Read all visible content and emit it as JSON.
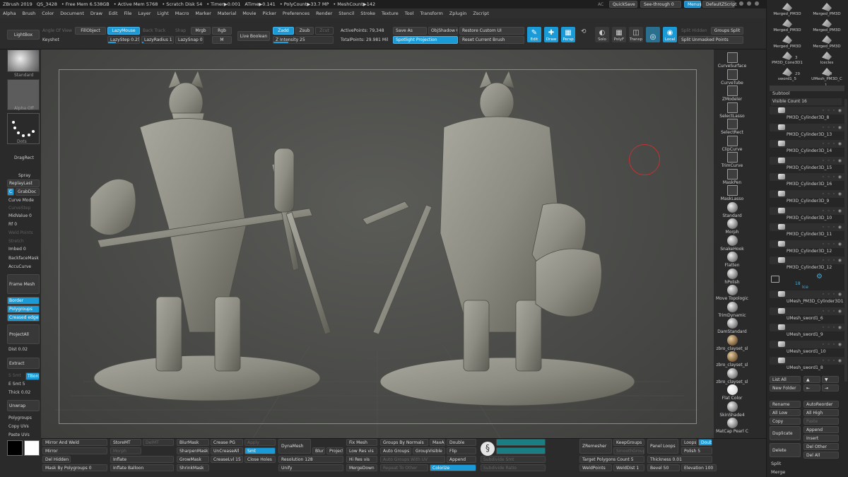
{
  "titlebar": {
    "app": "ZBrush 2019",
    "doc": "QS_3428",
    "stats": [
      "• Free Mem 6.538GB",
      "• Active Mem 5768",
      "• Scratch Disk 54",
      "• Timer▶0.001",
      "ATime▶0.141",
      "• PolyCount▶33.7 MP",
      "• MeshCount▶142"
    ],
    "ac": "AC",
    "quicksave": "QuickSave",
    "see_through": "See-through   0",
    "menus": "Menus",
    "default_zscript": "DefaultZScript"
  },
  "menubar": [
    "Alpha",
    "Brush",
    "Color",
    "Document",
    "Draw",
    "Edit",
    "File",
    "Layer",
    "Light",
    "Macro",
    "Marker",
    "Material",
    "Movie",
    "Picker",
    "Preferences",
    "Render",
    "Stencil",
    "Stroke",
    "Texture",
    "Tool",
    "Transform",
    "Zplugin",
    "Zscript"
  ],
  "shelf": {
    "lightbox": "LightBox",
    "keyshot": "Keyshot",
    "angle_of_view": "Angle Of View",
    "fill_object": "FillObject",
    "lazy_mouse": "LazyMouse",
    "back_track": "Back Track",
    "lazy_step": "LazyStep 0.25",
    "lazy_radius": "LazyRadius 1",
    "lazy_snap": "LazySnap 0",
    "mrgb": "Mrgb",
    "rgb": "Rgb",
    "m": "M",
    "shape": "Shap",
    "live_boolean": "Live Boolean",
    "zadd": "Zadd",
    "zsub": "Zsub",
    "zcut": "Zcut",
    "z_intensity": "Z Intensity 25",
    "active_points": "ActivePoints: 79,348",
    "total_points": "TotalPoints: 29.981 Mil",
    "save_as": "Save As",
    "obj_shadow": "ObjShadow 0",
    "spotlight_projection": "Spotlight Projection",
    "restore_custom_ui": "Restore Custom UI",
    "reset_current_brush": "Reset Current Brush",
    "edit": "Edit",
    "draw": "Draw",
    "persp": "Persp",
    "solo": "Solo",
    "polyf": "PolyF",
    "transp": "Transp",
    "local": "Local",
    "split_hidden": "Split Hidden",
    "groups_split": "Groups Split",
    "split_unmasked_points": "Split Unmasked Points"
  },
  "leftshelf": {
    "standard": "Standard",
    "alpha_off": "Alpha Off",
    "dots": "Dots",
    "dragrect": "DragRect",
    "spray": "Spray",
    "replay_last": "ReplayLast",
    "c": "C",
    "grab_doc": "GrabDoc",
    "curve_mode": "Curve Mode",
    "curve_step": "CurveStep",
    "mid_value": "MidValue 0",
    "rf": "Rf 0",
    "weld_points": "Weld Points",
    "stretch": "Stretch",
    "imbed": "Imbed 0",
    "backface_mask": "BackfaceMask",
    "accu_curve": "AccuCurve",
    "frame_mesh": "Frame Mesh",
    "border": "Border",
    "polygroups": "Polygroups",
    "creased_edges": "Creased edges",
    "project_all": "ProjectAll",
    "dist": "Dist 0.02",
    "extract": "Extract",
    "e_smt": "E Smt 5",
    "s_smt": "S Smt",
    "tborder": "TBorder",
    "thick": "Thick 0.02",
    "unwrap": "Unwrap",
    "polygroups2": "Polygroups",
    "copy_uvs": "Copy UVs",
    "paste_uvs": "Paste UVs"
  },
  "rightshelf": [
    {
      "name": "curvesurface-brush",
      "label": "CurveSurface",
      "kind": "spike"
    },
    {
      "name": "curvetube-brush",
      "label": "CurveTube",
      "kind": "tube"
    },
    {
      "name": "zmodeler-brush",
      "label": "ZModeler",
      "kind": "cube"
    },
    {
      "name": "selectlasso-tool",
      "label": "SelectLasso",
      "kind": "lasso"
    },
    {
      "name": "selectrect-tool",
      "label": "SelectRect",
      "kind": "rect"
    },
    {
      "name": "clipcurve-tool",
      "label": "ClipCurve",
      "kind": "lasso"
    },
    {
      "name": "trimcurve-tool",
      "label": "TrimCurve",
      "kind": "lasso"
    },
    {
      "name": "maskpen-tool",
      "label": "MaskPen",
      "kind": "lasso"
    },
    {
      "name": "masklasso-tool",
      "label": "MaskLasso",
      "kind": "lasso"
    },
    {
      "name": "standard-brush",
      "label": "Standard",
      "kind": "sphere"
    },
    {
      "name": "morph-brush",
      "label": "Morph",
      "kind": "sphere"
    },
    {
      "name": "snakehook-brush",
      "label": "SnakeHook",
      "kind": "sphere"
    },
    {
      "name": "flatten-brush",
      "label": "Flatten",
      "kind": "sphere"
    },
    {
      "name": "hpolish-brush",
      "label": "hPolish",
      "kind": "sphere"
    },
    {
      "name": "move-topological-brush",
      "label": "Move Topologic",
      "kind": "sphere"
    },
    {
      "name": "trimdynamic-brush",
      "label": "TrimDynamic",
      "kind": "sphere"
    },
    {
      "name": "damstandard-brush",
      "label": "DamStandard",
      "kind": "sphere"
    },
    {
      "name": "clayset-1",
      "label": "zbro_clayset_sl",
      "kind": "clay"
    },
    {
      "name": "clayset-2",
      "label": "zbro_clayset_sl",
      "kind": "clay"
    },
    {
      "name": "clayset-3",
      "label": "zbro_clayset_sl",
      "kind": "sphere"
    },
    {
      "name": "flat-color-material",
      "label": "Flat Color",
      "kind": "flat"
    },
    {
      "name": "skinshade4-material",
      "label": "SkinShade4",
      "kind": "sphere"
    },
    {
      "name": "matcap-pearl-material",
      "label": "MatCap Pearl C",
      "kind": "sphere"
    }
  ],
  "toolpanel": {
    "tiles": [
      [
        "Merged_PM3D",
        "Merged_PM3D"
      ],
      [
        "Merged_PM3D",
        "Merged_PM3D"
      ],
      [
        "Merged_PM3D",
        "Merged_PM3D"
      ],
      [
        "PM3D_Cone3D1",
        "Icecles"
      ],
      [
        "sword1_5",
        "UMesh_PM3D_C"
      ]
    ],
    "tile_counts": [
      "3",
      "10",
      "29",
      "160",
      "1"
    ],
    "subtool": "Subtool",
    "visible_count": "Visible Count 16",
    "subtools": [
      "PM3D_Cylinder3D_8",
      "PM3D_Cylinder3D_13",
      "PM3D_Cylinder3D_14",
      "PM3D_Cylinder3D_15",
      "PM3D_Cylinder3D_16",
      "PM3D_Cylinder3D_9",
      "PM3D_Cylinder3D_10",
      "PM3D_Cylinder3D_11",
      "PM3D_Cylinder3D_12",
      "PM3D_Cylinder3D_12"
    ],
    "folder_count": "18",
    "folder_name": "Ice",
    "subtools2": [
      "UMesh_PM3D_Cylinder3D1",
      "UMesh_sword1_6",
      "UMesh_sword1_9",
      "UMesh_sword1_10",
      "UMesh_sword1_8"
    ],
    "list_all": "List All",
    "new_folder": "New Folder",
    "rename": "Rename",
    "auto_reorder": "AutoReorder",
    "all_low": "All Low",
    "all_high": "All High",
    "copy": "Copy",
    "paste": "Paste",
    "duplicate": "Duplicate",
    "append": "Append",
    "insert": "Insert",
    "delete": "Delete",
    "del_other": "Del Other",
    "del_all": "Del All",
    "split": "Split",
    "merge": "Merge"
  },
  "bottomshelf": {
    "mirror_and_weld": "Mirror And Weld",
    "mirror": "Mirror",
    "del_hidden": "Del Hidden",
    "mask_by_polygroups": "Mask By Polygroups 0",
    "storemt": "StoreMT",
    "delmt": "DelMT",
    "morph": "Morph",
    "inflate": "Inflate",
    "inflate_balloon": "Inflate Balloon",
    "close_holes": "Close Holes",
    "blurmask": "BlurMask",
    "sharpenmask": "SharpenMask",
    "growmask": "GrowMask",
    "shrinkmask": "ShrinkMask",
    "crease_pg": "Crease PG",
    "uncrease_all": "UnCreaseAll",
    "crease_lvl": "CreaseLvl 15",
    "apply": "Apply",
    "smt": "Smt",
    "dynamesh": "DynaMesh",
    "blur": "Blur 2",
    "project": "Project",
    "resolution": "Resolution 128",
    "unify": "Unify",
    "fix_mesh": "Fix Mesh",
    "low_res_vis": "Low Res vis",
    "hi_res_vis": "Hi Res vis",
    "merge_down": "MergeDown",
    "groups_by_normals": "Groups By Normals",
    "maxan": "MaxAn",
    "auto_groups": "Auto Groups",
    "group_visible": "GroupVisible",
    "auto_groups_with_uv": "Auto Groups With UV",
    "repeat_to_other": "Repeat To Other",
    "double": "Double",
    "flip": "Flip",
    "append": "Append",
    "colorize": "Colorize",
    "subdivide_smt": "Subdivide Smt",
    "subdivide_ratio": "Subdivide Ratio",
    "zremesher": "ZRemesher",
    "keep_groups": "KeepGroups",
    "smooth_groups": "SmoothGroups",
    "target_polygons": "Target Polygons Count 5",
    "weld_points": "WeldPoints",
    "weld_dist": "WeldDist 1",
    "panel_loops": "Panel Loops",
    "loops": "Loops",
    "double2": "Double",
    "polish": "Polish 5",
    "thickness": "Thickness 0.01",
    "bevel": "Bevel 50",
    "elevation": "Elevation 100"
  },
  "colors": {
    "accent": "#1a9ad6",
    "viewport": "#4a4b48",
    "sculpt": "#8d8c82",
    "cursor_ring": "#c83030"
  }
}
